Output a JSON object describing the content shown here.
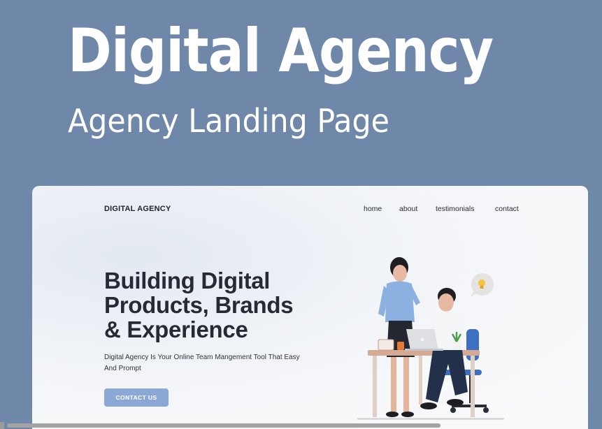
{
  "banner": {
    "title": "Digital Agency",
    "subtitle": "Agency Landing Page"
  },
  "site": {
    "brand": "DIGITAL AGENCY",
    "nav": [
      "home",
      "about",
      "testimonials",
      "contact"
    ],
    "hero": {
      "title_lines": [
        "Building Digital",
        "Products, Brands",
        "& Experience"
      ],
      "description": "Digital Agency Is Your Online Team Mangement Tool That Easy And Prompt",
      "cta_label": "CONTACT US"
    }
  },
  "colors": {
    "background": "#6f88aa",
    "card": "#f7f8fa",
    "cta": "#8ba7d6",
    "heading": "#262a35"
  },
  "icons": {
    "illustration": "team-at-desk-illustration",
    "bubble": "lightbulb-icon"
  }
}
